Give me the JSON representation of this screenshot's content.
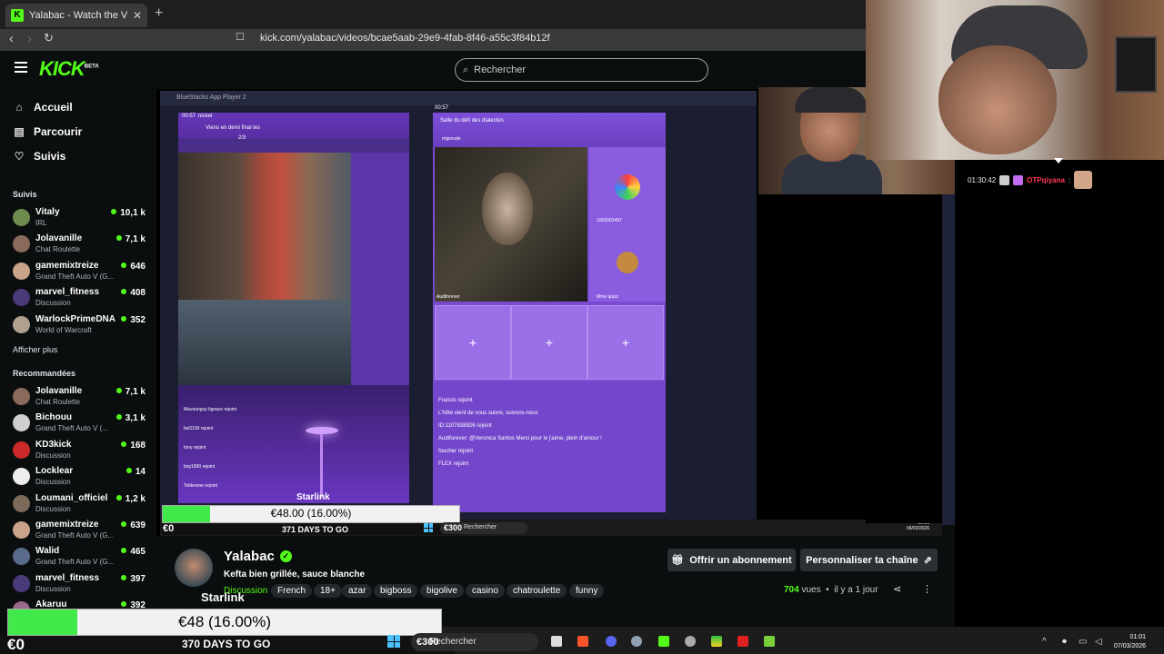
{
  "browser": {
    "tab_title": "Yalabac - Watch the VOD on Kick",
    "url": "kick.com/yalabac/videos/bcae5aab-29e9-4fab-8f46-a55c3f84b12f"
  },
  "header": {
    "logo": "KICK",
    "logo_badge": "BETA",
    "search_placeholder": "Rechercher"
  },
  "nav": [
    {
      "label": "Accueil",
      "icon": "home-icon"
    },
    {
      "label": "Parcourir",
      "icon": "browse-icon"
    },
    {
      "label": "Suivis",
      "icon": "heart-icon"
    }
  ],
  "following": {
    "title": "Suivis",
    "channels": [
      {
        "name": "Vitaly",
        "category": "IRL",
        "viewers": "10,1 k",
        "color": "#6d8a4f"
      },
      {
        "name": "Jolavanille",
        "category": "Chat Roulette",
        "viewers": "7,1 k",
        "color": "#8a6a5a"
      },
      {
        "name": "gamemixtreize",
        "category": "Grand Theft Auto V (G...",
        "viewers": "646",
        "color": "#caa38a"
      },
      {
        "name": "marvel_fitness",
        "category": "Discussion",
        "viewers": "408",
        "color": "#4a3a7a"
      },
      {
        "name": "WarlockPrimeDNA",
        "category": "World of Warcraft",
        "viewers": "352",
        "color": "#b0a090"
      }
    ],
    "show_more": "Afficher plus"
  },
  "recommended": {
    "title": "Recommandées",
    "channels": [
      {
        "name": "Jolavanille",
        "category": "Chat Roulette",
        "viewers": "7,1 k",
        "color": "#8a6a5a"
      },
      {
        "name": "Bichouu",
        "category": "Grand Theft Auto V (...",
        "viewers": "3,1 k",
        "color": "#cfcfcf"
      },
      {
        "name": "KD3kick",
        "category": "Discussion",
        "viewers": "168",
        "color": "#cc2a2a"
      },
      {
        "name": "Locklear",
        "category": "Discussion",
        "viewers": "14",
        "color": "#eeeeee"
      },
      {
        "name": "Loumani_officiel",
        "category": "Discussion",
        "viewers": "1,2 k",
        "color": "#7a6a5a"
      },
      {
        "name": "gamemixtreize",
        "category": "Grand Theft Auto V (G...",
        "viewers": "639",
        "color": "#caa38a"
      },
      {
        "name": "Walid",
        "category": "Grand Theft Auto V (G...",
        "viewers": "465",
        "color": "#5a6a8a"
      },
      {
        "name": "marvel_fitness",
        "category": "Discussion",
        "viewers": "397",
        "color": "#4a3a7a"
      },
      {
        "name": "Akaruu",
        "category": "",
        "viewers": "392",
        "color": "#9a6a8a"
      }
    ]
  },
  "video_overlay": {
    "bluestacks_title": "BlueStacks App Player 2",
    "left_phone_time": "00:57",
    "left_phone_title": "nickel",
    "left_phone_banner": "Viens en demi final tes",
    "left_phone_counter": "2/3",
    "left_phone_chat": [
      "Mavounguy lignace rejoint",
      "bel1190 rejoint",
      "tony rejoint",
      "boy1890 rejoint",
      "Toblerone rejoint"
    ],
    "right_phone_time": "00:57",
    "right_phone_title": "Salle du défi des dialectes",
    "right_phone_tag": "régionale",
    "right_phone_user": "Audiforever",
    "right_phone_side_user1": "1002003497",
    "right_phone_side_user2": "Mme quizz",
    "right_phone_chat": [
      "Francis rejoint",
      "L'hôte vient de vous suivre, suivons-nous",
      "ID:1107838926 rejoint",
      "Audiforever: @Veronica Santos Merci pour le j'aime, plein d'amour !",
      "foucher rejoint",
      "FLEX rejoint"
    ],
    "starlink_small": "Starlink",
    "inner_clock_time": "00:56",
    "inner_clock_date": "06/03/2026"
  },
  "chat": {
    "time": "01:30:42",
    "user": "OTPqiyana",
    "separator": ":"
  },
  "streamer": {
    "name": "Yalabac",
    "title": "Kefta bien grillée, sauce blanche",
    "category": "Discussion",
    "tags": [
      "French",
      "18+",
      "azar",
      "bigboss",
      "bigolive",
      "casino",
      "chatroulette",
      "funny"
    ],
    "views_count": "704",
    "views_label": "vues",
    "time_ago": "il y a 1 jour",
    "subscribe_label": "Offrir un abonnement",
    "customize_label": "Personnaliser ta chaîne"
  },
  "obs_overlay": {
    "goal_small": "€48.00 (16.00%)",
    "goal_small_progress": 0.16,
    "euro_small": "€0",
    "days_small": "371 DAYS TO GO",
    "search_small": "Rechercher",
    "s300_small": "€300",
    "starlink": "Starlink",
    "goal_big": "€48 (16.00%)",
    "goal_big_progress": 0.16,
    "euro_big": "€0",
    "days_big": "370 DAYS TO GO",
    "s300_big": "€300"
  },
  "taskbar": {
    "search_placeholder": "Rechercher",
    "time": "01:01",
    "date": "07/03/2026"
  },
  "colors": {
    "accent": "#53fc18",
    "background": "#0b0e0f",
    "goal_fill": "#41ea4a"
  }
}
